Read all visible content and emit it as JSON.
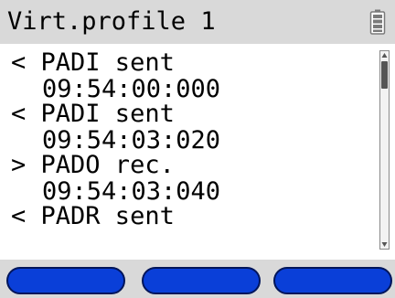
{
  "header": {
    "title": "Virt.profile 1",
    "battery_icon": "battery-icon"
  },
  "log": {
    "entries": [
      {
        "direction": "<",
        "message": "PADI sent",
        "time": "09:54:00:000"
      },
      {
        "direction": "<",
        "message": "PADI sent",
        "time": "09:54:03:020"
      },
      {
        "direction": ">",
        "message": "PADO rec.",
        "time": "09:54:03:040"
      },
      {
        "direction": "<",
        "message": "PADR sent",
        "time": ""
      }
    ]
  },
  "softkeys": [
    {
      "label": ""
    },
    {
      "label": ""
    },
    {
      "label": ""
    }
  ],
  "colors": {
    "header_bg": "#d9d9d9",
    "softkey_fill": "#0a3fd8",
    "softkey_border": "#00155a",
    "text": "#000000"
  }
}
